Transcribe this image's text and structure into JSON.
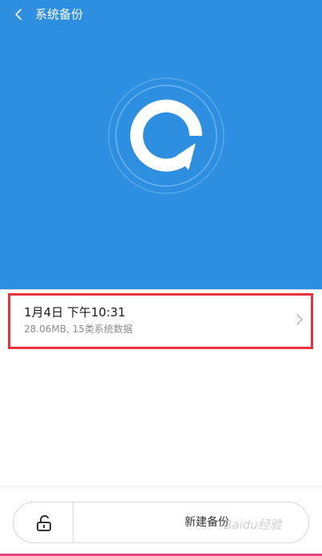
{
  "header": {
    "title": "系统备份",
    "accent_color": "#2e8fe0"
  },
  "backup_list": [
    {
      "time": "1月4日 下午10:31",
      "detail": "28.06MB, 15类系统数据"
    }
  ],
  "footer": {
    "lock_icon": "unlock-icon",
    "new_backup_label": "新建备份"
  },
  "watermark": "Baidu经验",
  "highlight_color": "#e8323c"
}
